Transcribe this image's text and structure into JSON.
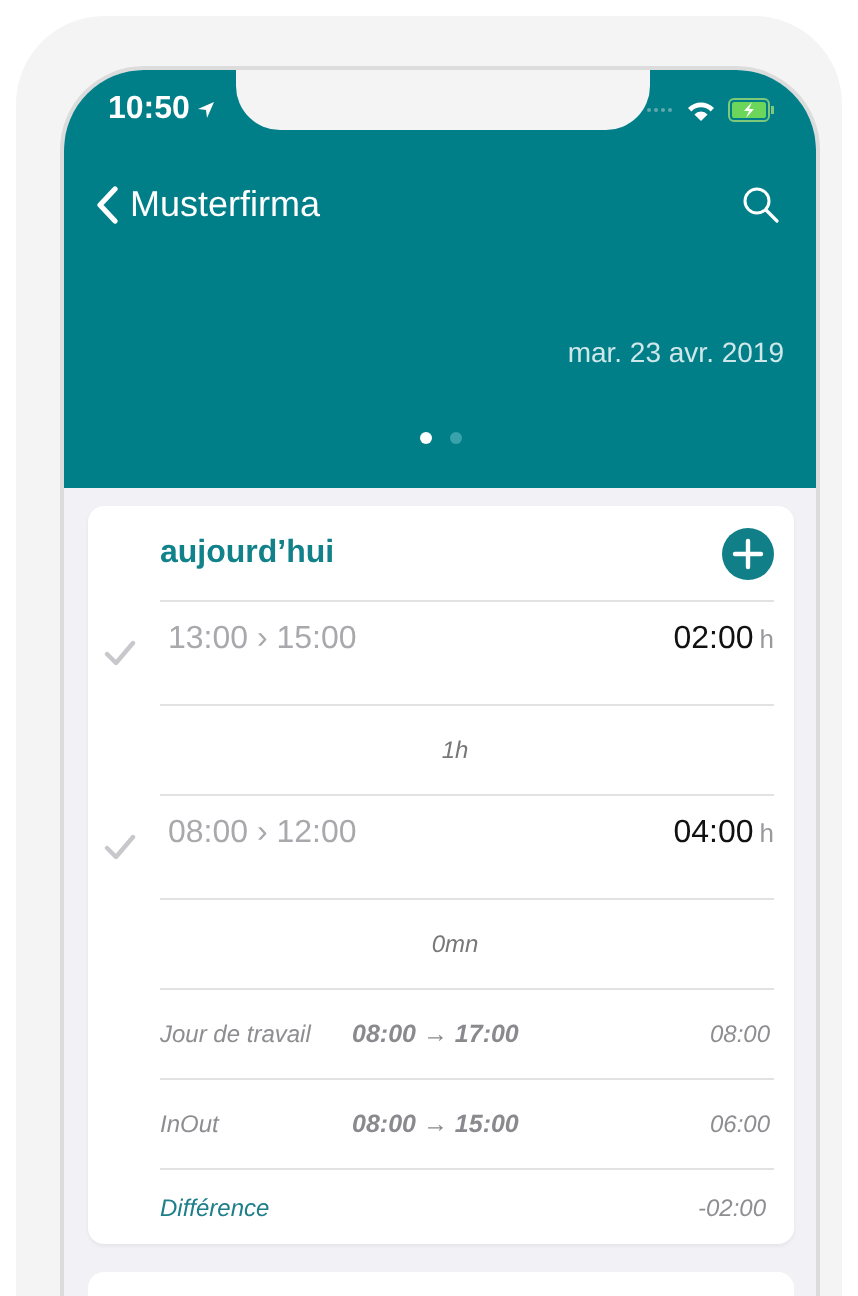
{
  "status_bar": {
    "time": "10:50"
  },
  "nav": {
    "back_label": "Musterfirma"
  },
  "header": {
    "date": "mar. 23 avr. 2019",
    "pages": [
      {
        "selected": true
      },
      {
        "selected": false
      }
    ]
  },
  "day": {
    "title": "aujourd’hui",
    "entries": [
      {
        "kind": "entry",
        "range": "13:00 › 15:00",
        "duration": "02:00",
        "unit": "h",
        "done": true
      },
      {
        "kind": "break",
        "label": "1h"
      },
      {
        "kind": "entry",
        "range": "08:00 › 12:00",
        "duration": "04:00",
        "unit": "h",
        "done": true
      },
      {
        "kind": "break",
        "label": "0mn"
      }
    ],
    "summary": [
      {
        "label": "Jour de travail",
        "range": "08:00 → 17:00",
        "total": "08:00"
      },
      {
        "label": "InOut",
        "range": "08:00 → 15:00",
        "total": "06:00"
      }
    ],
    "difference": {
      "label": "Différence",
      "value": "-02:00"
    }
  }
}
